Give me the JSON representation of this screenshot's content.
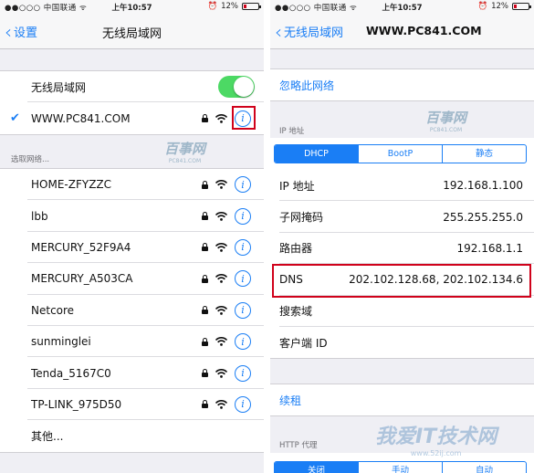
{
  "left": {
    "status": {
      "carrier": "中国联通",
      "time": "上午10:57",
      "battery": "12%"
    },
    "nav": {
      "back": "设置",
      "title": "无线局域网"
    },
    "wifi_toggle_label": "无线局域网",
    "wifi_on": true,
    "connected": "WWW.PC841.COM",
    "choose_header": "选取网络...",
    "networks": [
      {
        "name": "HOME-ZFYZZC"
      },
      {
        "name": "lbb"
      },
      {
        "name": "MERCURY_52F9A4"
      },
      {
        "name": "MERCURY_A503CA"
      },
      {
        "name": "Netcore"
      },
      {
        "name": "sunminglei"
      },
      {
        "name": "Tenda_5167C0"
      },
      {
        "name": "TP-LINK_975D50"
      }
    ],
    "other": "其他...",
    "watermark": {
      "title": "百事网",
      "sub": "PC841.COM"
    }
  },
  "right": {
    "status": {
      "carrier": "中国联通",
      "time": "上午10:57",
      "battery": "12%"
    },
    "nav": {
      "back": "无线局域网",
      "title": "WWW.PC841.COM"
    },
    "forget": "忽略此网络",
    "ip_header": "IP 地址",
    "modes": [
      "DHCP",
      "BootP",
      "静态"
    ],
    "selected_mode": "DHCP",
    "fields": [
      {
        "label": "IP 地址",
        "value": "192.168.1.100"
      },
      {
        "label": "子网掩码",
        "value": "255.255.255.0"
      },
      {
        "label": "路由器",
        "value": "192.168.1.1"
      },
      {
        "label": "DNS",
        "value": "202.102.128.68, 202.102.134.6"
      },
      {
        "label": "搜索域",
        "value": ""
      },
      {
        "label": "客户端 ID",
        "value": ""
      }
    ],
    "renew": "续租",
    "proxy_header": "HTTP 代理",
    "proxy_modes": [
      "关闭",
      "手动",
      "自动"
    ],
    "watermark": {
      "title": "百事网",
      "sub": "PC841.COM"
    },
    "site_watermark": {
      "title": "我爱IT技术网",
      "sub": "www.52ij.com"
    }
  },
  "colors": {
    "accent": "#1a7ef5",
    "toggle_on": "#4cd964",
    "highlight": "#d0021b"
  }
}
